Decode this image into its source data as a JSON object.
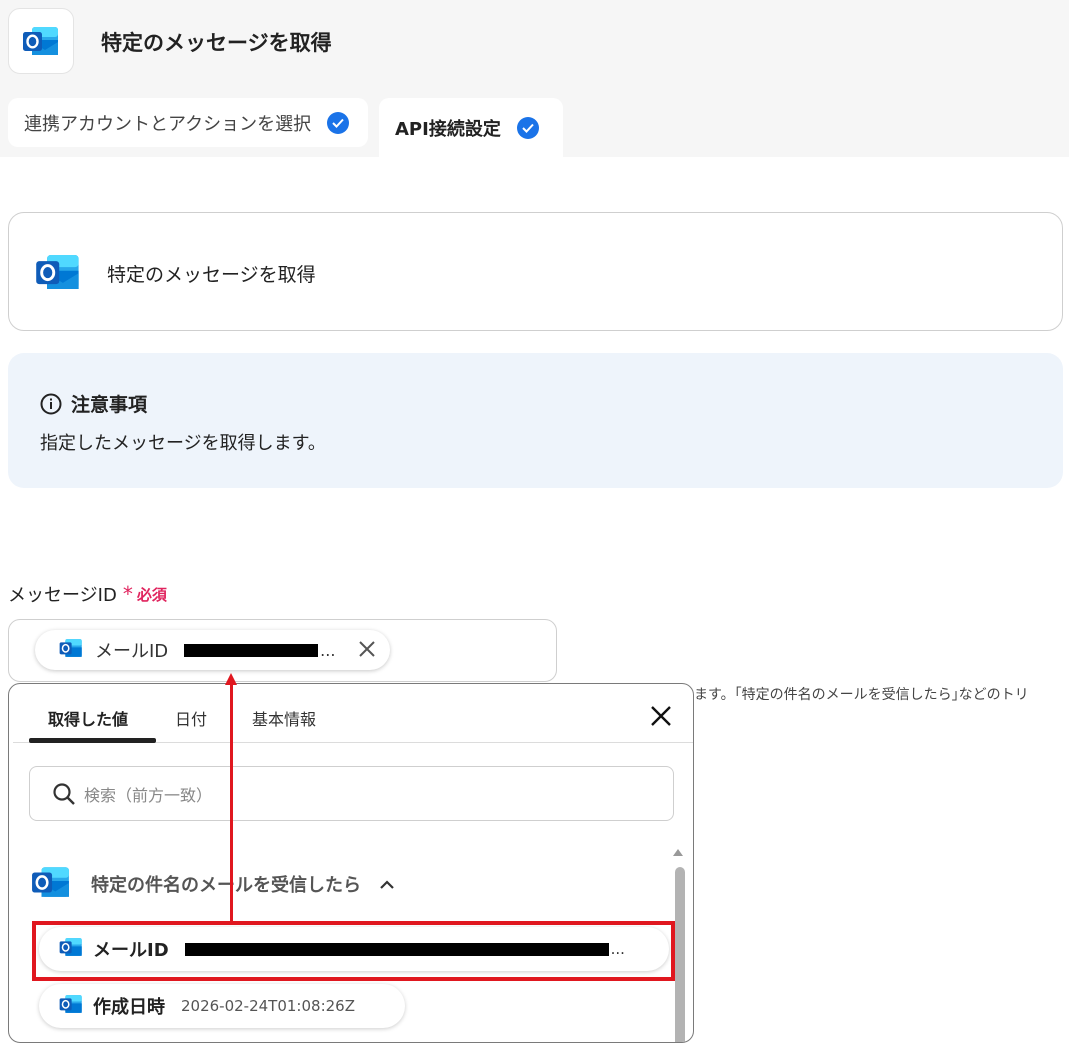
{
  "header": {
    "title": "特定のメッセージを取得",
    "icon": "outlook-icon"
  },
  "tabs": [
    {
      "label": "連携アカウントとアクションを選択",
      "status": "done"
    },
    {
      "label": "API接続設定",
      "status": "done",
      "active": true
    }
  ],
  "action_card": {
    "title": "特定のメッセージを取得"
  },
  "notice": {
    "heading": "注意事項",
    "body": "指定したメッセージを取得します。"
  },
  "field": {
    "label": "メッセージID",
    "required_mark": "*",
    "required_text": "必須",
    "chip": {
      "label": "メールID",
      "value_redacted": true,
      "ellipsis": "..."
    }
  },
  "helper_text": "ます。｢特定の件名のメールを受信したら｣などのトリ",
  "popup": {
    "tabs": [
      "取得した値",
      "日付",
      "基本情報"
    ],
    "active_tab": "取得した値",
    "search_placeholder": "検索（前方一致）",
    "group": {
      "label": "特定の件名のメールを受信したら",
      "expanded": true
    },
    "items": [
      {
        "label": "メールID",
        "value_redacted": true,
        "ellipsis": "..."
      },
      {
        "label": "作成日時",
        "value": "2026-02-24T01:08:26Z"
      }
    ]
  },
  "colors": {
    "accent": "#1a73e8",
    "required": "#e0245e",
    "annotation": "#e0171f",
    "notice_bg": "#eef4fb"
  }
}
